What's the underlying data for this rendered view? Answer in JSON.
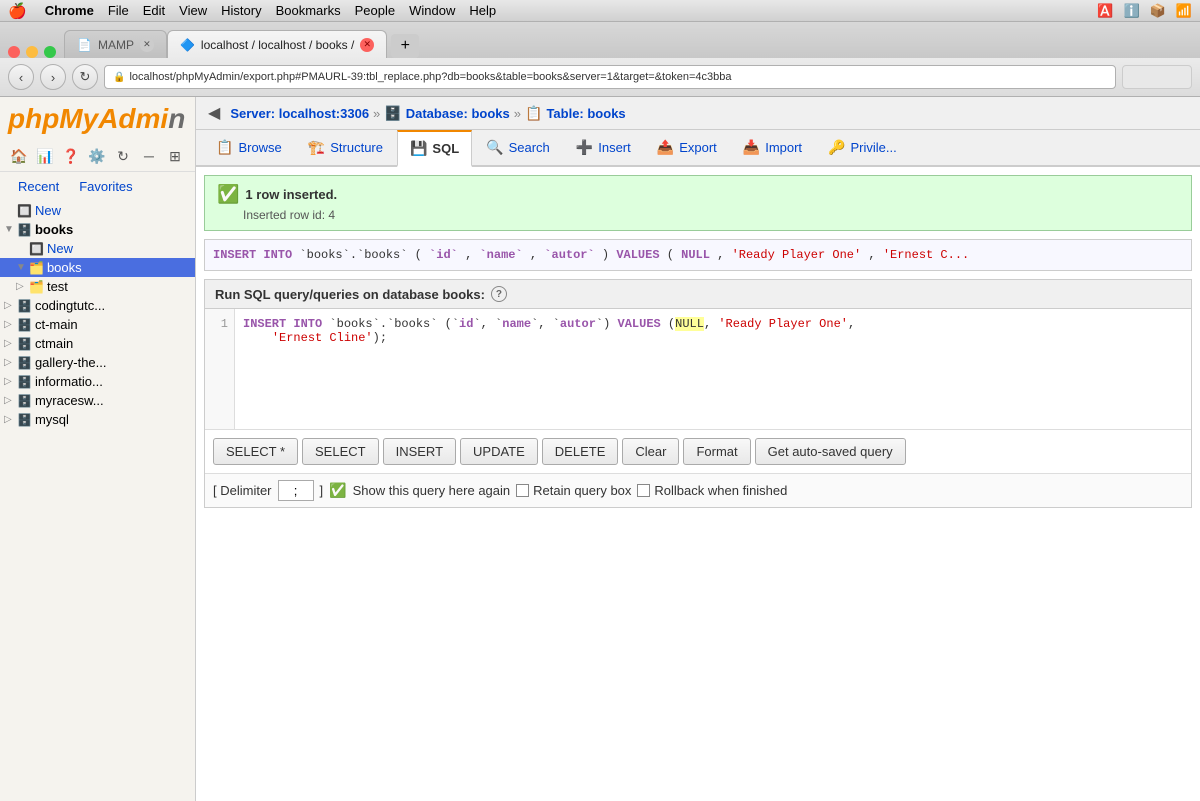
{
  "os": {
    "menubar_items": [
      "🍎",
      "Chrome",
      "File",
      "Edit",
      "View",
      "History",
      "Bookmarks",
      "People",
      "Window",
      "Help"
    ]
  },
  "browser": {
    "tabs": [
      {
        "label": "MAMP",
        "active": false,
        "icon": "📄"
      },
      {
        "label": "localhost / localhost / books /",
        "active": true,
        "icon": "🔷"
      }
    ],
    "address": "localhost/phpMyAdmin/export.php#PMAURL-39:tbl_replace.php?db=books&table=books&server=1&target=&token=4c3bba"
  },
  "sidebar": {
    "logo": "phpMyAdmi",
    "logo_color": "phpMyAdmin",
    "recent_label": "Recent",
    "favorites_label": "Favorites",
    "tree": [
      {
        "label": "New",
        "indent": 0,
        "type": "new",
        "icon": "🔲"
      },
      {
        "label": "books",
        "indent": 0,
        "type": "db",
        "icon": "🗄️",
        "expanded": true
      },
      {
        "label": "New",
        "indent": 1,
        "type": "new",
        "icon": "🔲"
      },
      {
        "label": "books",
        "indent": 1,
        "type": "table",
        "icon": "🗂️",
        "selected": true
      },
      {
        "label": "test",
        "indent": 1,
        "type": "table",
        "icon": "🗂️"
      },
      {
        "label": "codingtutc...",
        "indent": 0,
        "type": "db",
        "icon": "🗄️"
      },
      {
        "label": "ct-main",
        "indent": 0,
        "type": "db",
        "icon": "🗄️"
      },
      {
        "label": "ctmain",
        "indent": 0,
        "type": "db",
        "icon": "🗄️"
      },
      {
        "label": "gallery-the...",
        "indent": 0,
        "type": "db",
        "icon": "🗄️"
      },
      {
        "label": "informatio...",
        "indent": 0,
        "type": "db",
        "icon": "🗄️"
      },
      {
        "label": "myracesw...",
        "indent": 0,
        "type": "db",
        "icon": "🗄️"
      },
      {
        "label": "mysql",
        "indent": 0,
        "type": "db",
        "icon": "🗄️"
      }
    ]
  },
  "breadcrumb": {
    "server": "Server: localhost:3306",
    "database": "Database: books",
    "table": "Table: books"
  },
  "tabs": [
    {
      "label": "Browse",
      "icon": "📋"
    },
    {
      "label": "Structure",
      "icon": "🏗️"
    },
    {
      "label": "SQL",
      "icon": "💾",
      "active": true
    },
    {
      "label": "Search",
      "icon": "🔍"
    },
    {
      "label": "Insert",
      "icon": "➕"
    },
    {
      "label": "Export",
      "icon": "📤"
    },
    {
      "label": "Import",
      "icon": "📥"
    },
    {
      "label": "Privile...",
      "icon": "🔑"
    }
  ],
  "notice": {
    "success_text": "1 row inserted.",
    "inserted_row": "Inserted row id: 4"
  },
  "sql_display": {
    "code": "INSERT INTO `books`.`books` (`id`, `name`, `autor`) VALUES (NULL, 'Ready Player One', 'Ernest C..."
  },
  "query_section": {
    "header": "Run SQL query/queries on database books:",
    "line_number": "1",
    "query_text": "INSERT INTO `books`.`books` (`id`, `name`, `autor`) VALUES (NULL, 'Ready Player One',",
    "query_text2": "    'Ernest Cline');",
    "buttons": [
      "SELECT *",
      "SELECT",
      "INSERT",
      "UPDATE",
      "DELETE",
      "Clear",
      "Format",
      "Get auto-saved query"
    ],
    "delimiter_label": "[ Delimiter",
    "delimiter_value": ";",
    "delimiter_end": "]",
    "show_query_label": "Show this query here again",
    "retain_label": "Retain query box",
    "rollback_label": "Rollback when finished"
  }
}
